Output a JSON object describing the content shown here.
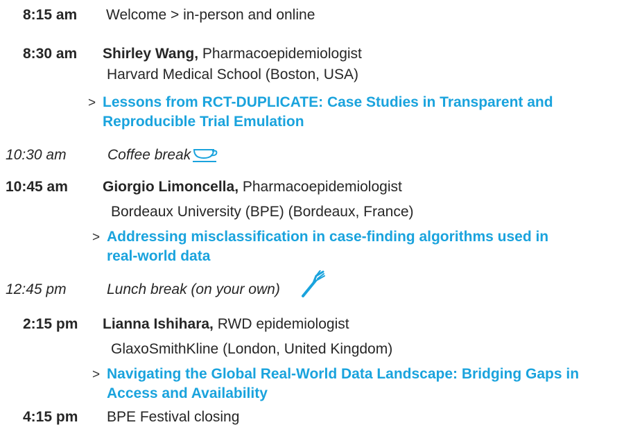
{
  "agenda": [
    {
      "time": "8:15 am",
      "text": "Welcome > in-person and online"
    },
    {
      "time": "8:30 am",
      "speaker": "Shirley Wang,",
      "role": " Pharmacoepidemiologist",
      "affiliation": "Harvard Medical School (Boston, USA)",
      "talk_line1": "Lessons from RCT-DUPLICATE: Case Studies in Transparent and",
      "talk_line2": "Reproducible Trial Emulation"
    },
    {
      "time": "10:30 am",
      "text": "Coffee break",
      "icon": "coffee-cup-icon"
    },
    {
      "time": "10:45 am",
      "speaker": "Giorgio Limoncella,",
      "role": " Pharmacoepidemiologist",
      "affiliation": "Bordeaux University (BPE) (Bordeaux, France)",
      "talk_line1": "Addressing misclassification in case-finding algorithms used in",
      "talk_line2": "real-world data"
    },
    {
      "time": "12:45 pm",
      "text": "Lunch break (on your own)",
      "icon": "fork-icon"
    },
    {
      "time": "2:15 pm",
      "speaker": "Lianna Ishihara,",
      "role": " RWD epidemiologist",
      "affiliation": "GlaxoSmithKline (London, United Kingdom)",
      "talk_line1": "Navigating the Global Real-World Data Landscape: Bridging Gaps in",
      "talk_line2": "Access and Availability"
    },
    {
      "time": "4:15 pm",
      "text": "BPE Festival closing"
    }
  ],
  "arrow": ">",
  "colors": {
    "accent": "#1aa3dd",
    "text": "#262626"
  }
}
